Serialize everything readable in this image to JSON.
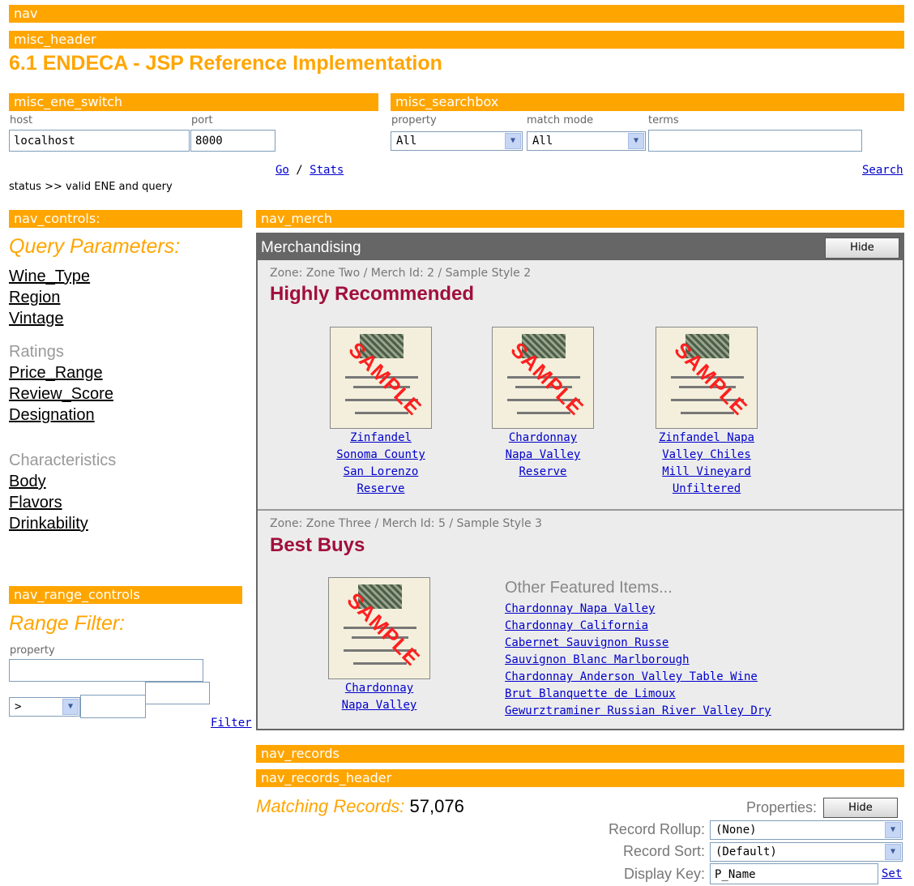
{
  "bars": {
    "nav": "nav",
    "misc_header": "misc_header",
    "misc_ene_switch": "misc_ene_switch",
    "misc_searchbox": "misc_searchbox",
    "nav_controls": "nav_controls:",
    "nav_merch": "nav_merch",
    "nav_range_controls": "nav_range_controls",
    "nav_records": "nav_records",
    "nav_records_header": "nav_records_header"
  },
  "page_title": "6.1 ENDECA - JSP Reference Implementation",
  "ene_switch": {
    "host_label": "host",
    "host_value": "localhost",
    "port_label": "port",
    "port_value": "8000",
    "go": "Go",
    "sep": "/",
    "stats": "Stats"
  },
  "searchbox": {
    "property_label": "property",
    "property_value": "All",
    "match_mode_label": "match mode",
    "match_mode_value": "All",
    "terms_label": "terms",
    "terms_value": "",
    "search": "Search"
  },
  "status": "status >> valid ENE and query",
  "nav_controls": {
    "heading": "Query Parameters:",
    "group1": [
      "Wine_Type",
      "Region",
      "Vintage"
    ],
    "group2_title": "Ratings",
    "group2": [
      "Price_Range",
      "Review_Score",
      "Designation"
    ],
    "group3_title": "Characteristics",
    "group3": [
      "Body",
      "Flavors",
      "Drinkability"
    ]
  },
  "range_controls": {
    "heading": "Range Filter:",
    "property_label": "property",
    "operator": ">",
    "filter": "Filter"
  },
  "merch": {
    "title": "Merchandising",
    "hide": "Hide",
    "stamp": "SAMPLE",
    "zone1": {
      "meta": "Zone: Zone Two / Merch Id: 2 / Sample Style 2",
      "heading": "Highly Recommended",
      "items": [
        [
          "Zinfandel",
          "Sonoma County",
          "San Lorenzo",
          "Reserve"
        ],
        [
          "Chardonnay",
          "Napa Valley",
          "Reserve"
        ],
        [
          "Zinfandel Napa",
          "Valley Chiles",
          "Mill Vineyard",
          "Unfiltered"
        ]
      ]
    },
    "zone2": {
      "meta": "Zone: Zone Three / Merch Id: 5 / Sample Style 3",
      "heading": "Best Buys",
      "item": [
        "Chardonnay",
        "Napa Valley"
      ],
      "other_title": "Other Featured Items...",
      "other": [
        "Chardonnay Napa Valley",
        "Chardonnay California",
        "Cabernet Sauvignon Russe",
        "Sauvignon Blanc Marlborough",
        "Chardonnay Anderson Valley Table Wine",
        "Brut Blanquette de Limoux",
        "Gewurztraminer Russian River Valley Dry"
      ]
    }
  },
  "records": {
    "matching_label": "Matching Records:",
    "matching_count": "57,076",
    "properties_label": "Properties:",
    "hide": "Hide",
    "rollup_label": "Record Rollup:",
    "rollup_value": "(None)",
    "sort_label": "Record Sort:",
    "sort_value": "(Default)",
    "display_key_label": "Display Key:",
    "display_key_value": "P_Name",
    "set": "Set"
  },
  "colors": {
    "accent": "#ffa500",
    "merch_header": "#666666",
    "merch_bg": "#ececec",
    "heading": "#a10f3c",
    "link": "#0000cc"
  }
}
